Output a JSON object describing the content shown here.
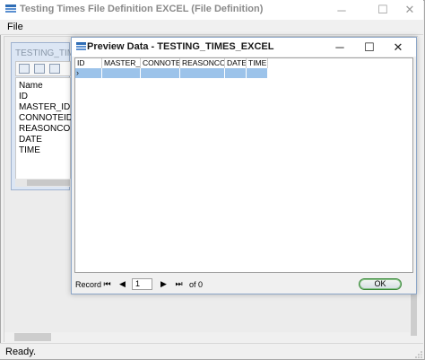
{
  "window": {
    "title": "Testing Times File Definition EXCEL (File Definition)",
    "menu": {
      "file": "File"
    },
    "status": "Ready."
  },
  "designer_panel": {
    "title": "TESTING_TIMES_E",
    "header": "Name",
    "fields": [
      "ID",
      "MASTER_ID",
      "CONNOTEID",
      "REASONCODE",
      "DATE",
      "TIME"
    ]
  },
  "dialog": {
    "title": "Preview Data - TESTING_TIMES_EXCEL",
    "columns": [
      "ID",
      "MASTER_ID",
      "CONNOTEID",
      "REASONCODE",
      "DATE",
      "TIME"
    ],
    "row_indicator": "›",
    "navigator": {
      "record_label": "Record",
      "position": "1",
      "of_label": "of 0"
    },
    "ok_label": "OK"
  },
  "icons": {
    "minimize": "─",
    "maximize": "☐",
    "close": "✕",
    "first": "⏮",
    "prev": "◀",
    "next": "▶",
    "last": "⏭"
  },
  "colors": {
    "selection": "#9cc3ea",
    "ok_border": "#3b8a3b"
  }
}
